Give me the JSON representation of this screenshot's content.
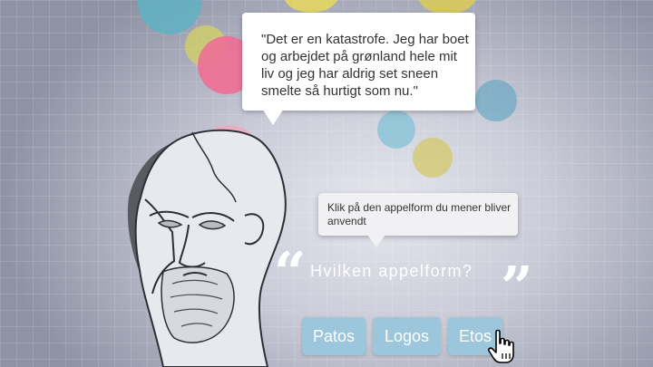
{
  "quote": {
    "text": "\"Det er en katastrofe. Jeg har boet og arbejdet på grønland hele mit liv og jeg har aldrig set sneen smelte så hurtigt som nu.\""
  },
  "hint": {
    "text": "Klik på den appelform du mener bliver anvendt"
  },
  "question": {
    "open_mark": "“",
    "text": "Hvilken appelform?",
    "close_mark": "”"
  },
  "answers": [
    {
      "label": "Patos"
    },
    {
      "label": "Logos"
    },
    {
      "label": "Etos"
    }
  ],
  "colors": {
    "button": "#9cc6dc",
    "bubble_teal": "#6ab4c4",
    "bubble_yellow": "#e8d84f",
    "bubble_pink": "#f27a9a",
    "bubble_olive": "#c7c86a"
  },
  "icons": {
    "cursor": "hand-pointer-icon",
    "portrait": "philosopher-bust-illustration"
  }
}
